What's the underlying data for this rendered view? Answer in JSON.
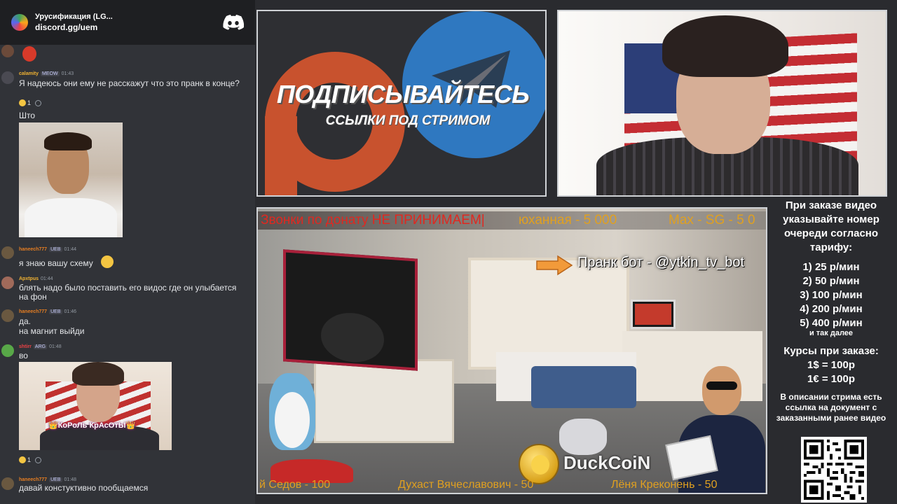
{
  "chat": {
    "server_title": "Урусификация (LG...",
    "server_link": "discord.gg/uem",
    "messages": [
      {
        "name": "calamity",
        "name_color": "#f0b232",
        "badge": "MEOW",
        "time": "01:43",
        "text": "Я надеюсь они ему не расскажут что это пранк в конце?",
        "reaction_count": "1"
      },
      {
        "text": "Што"
      },
      {
        "name": "haneech777",
        "name_color": "#e67e22",
        "badge": "UEB",
        "time": "01:44",
        "text": "я знаю вашу схему"
      },
      {
        "name": "Apxtpus",
        "name_color": "#f0b232",
        "time": "01:44",
        "text": "блять надо было поставить его видос где он улыбается на фон"
      },
      {
        "name": "haneech777",
        "name_color": "#e67e22",
        "badge": "UEB",
        "time": "01:46",
        "text": "да."
      },
      {
        "text": "на магнит выйди"
      },
      {
        "name": "shtirr",
        "name_color": "#ed4245",
        "badge": "ARG",
        "time": "01:48",
        "text": "во",
        "sticker_caption": "👑КоРоЛь КрАсОтЫ👑",
        "reaction_count": "1"
      },
      {
        "name": "haneech777",
        "name_color": "#e67e22",
        "badge": "UEB",
        "time": "01:48",
        "text": "давай констуктивно пообщаемся"
      }
    ]
  },
  "banner": {
    "headline": "ПОДПИСЫВАЙТЕСЬ",
    "subline": "ССЫЛКИ ПОД СТРИМОМ"
  },
  "scene": {
    "ticker_top": [
      "Звонки по донату НЕ ПРИНИМАЕМ|",
      "юханная - 5 000",
      "Max - SG - 5 0"
    ],
    "ticker_bottom": [
      "й Седов - 100",
      "Духаст Вячеславович - 50",
      "Лёня Креконень - 50"
    ],
    "prank_bot": "Пранк бот - @ytkin_tv_bot",
    "coin_label": "DuckCoiN"
  },
  "info": {
    "order_note": "При заказе видео указывайте номер очереди согласно тарифу:",
    "rates": [
      "1) 25 р/мин",
      "2) 50 р/мин",
      "3) 100 р/мин",
      "4) 200 р/мин",
      "5) 400 р/мин"
    ],
    "etc": "и так далее",
    "currency_title": "Курсы при заказе:",
    "currency": [
      "1$ = 100р",
      "1€ = 100р"
    ],
    "doc_note": "В описании стрима есть ссылка на документ с заказанными ранее видео"
  },
  "colors": {
    "discord_bg": "#313338",
    "discord_header": "#1e1f22",
    "accent_red": "#e02820",
    "accent_gold": "#e0a020"
  },
  "icons": {
    "discord": "discord-logo-icon",
    "patreon": "patreon-logo-icon",
    "telegram": "telegram-plane-icon",
    "qr": "qr-code"
  }
}
